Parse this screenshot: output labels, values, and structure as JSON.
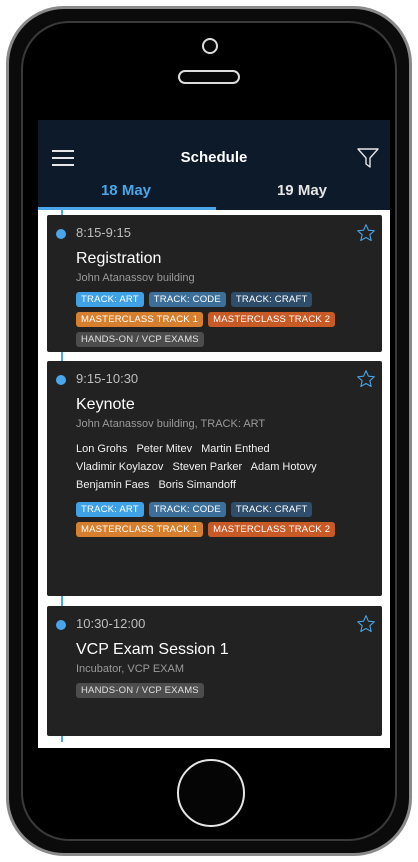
{
  "header": {
    "title": "Schedule"
  },
  "tabs": [
    {
      "label": "18 May"
    },
    {
      "label": "19 May"
    }
  ],
  "sessions": [
    {
      "time": "8:15-9:15",
      "title": "Registration",
      "location": "John Atanassov building",
      "speakers": [],
      "tags": [
        "TRACK: ART",
        "TRACK: CODE",
        "TRACK: CRAFT",
        "MASTERCLASS TRACK 1",
        "MASTERCLASS TRACK 2",
        "HANDS-ON / VCP EXAMS"
      ]
    },
    {
      "time": "9:15-10:30",
      "title": "Keynote",
      "location": "John Atanassov building, TRACK: ART",
      "speakers": [
        "Lon Grohs",
        "Peter Mitev",
        "Martin Enthed",
        "Vladimir Koylazov",
        "Steven Parker",
        "Adam Hotovy",
        "Benjamin Faes",
        "Boris Simandoff"
      ],
      "tags": [
        "TRACK: ART",
        "TRACK: CODE",
        "TRACK: CRAFT",
        "MASTERCLASS TRACK 1",
        "MASTERCLASS TRACK 2"
      ]
    },
    {
      "time": "10:30-12:00",
      "title": "VCP Exam Session 1",
      "location": "Incubator, VCP EXAM",
      "speakers": [],
      "tags": [
        "HANDS-ON / VCP EXAMS"
      ]
    }
  ],
  "colors": {
    "accent": "#4aa6e8",
    "nav_bg": "#0c1a2a",
    "card_bg": "#222222"
  },
  "icons": [
    "menu-icon",
    "filter-icon",
    "star-icon"
  ]
}
